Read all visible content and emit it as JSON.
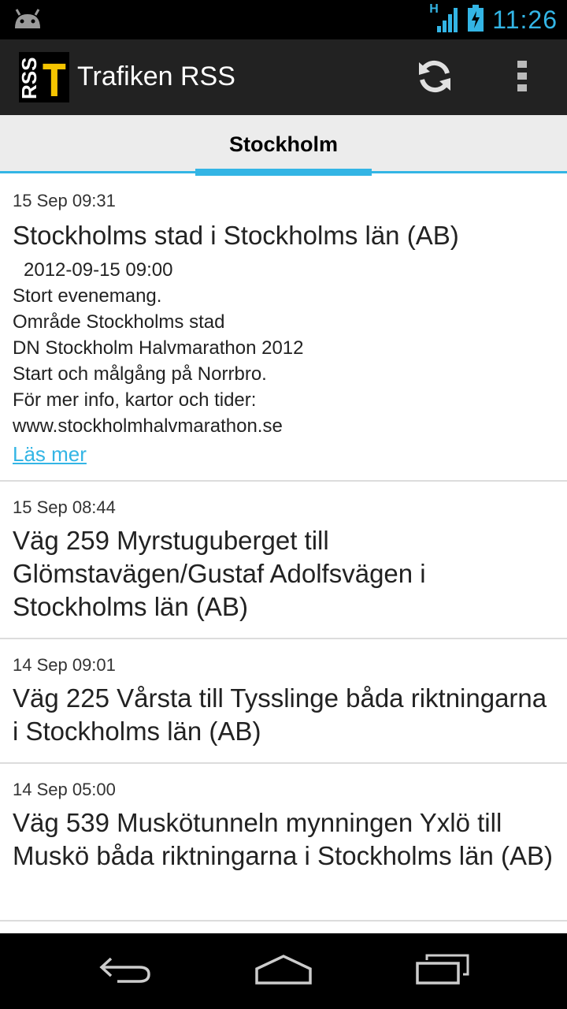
{
  "status_bar": {
    "time": "11:26",
    "network_label": "H",
    "icons": [
      "android-notification-icon",
      "signal-icon",
      "battery-charging-icon"
    ]
  },
  "action_bar": {
    "app_icon_text_rss": "RSS",
    "app_icon_text_t": "T",
    "title": "Trafiken RSS",
    "actions": [
      "refresh-icon",
      "overflow-menu-icon"
    ]
  },
  "tabs": [
    {
      "label": "Stockholm",
      "selected": true
    }
  ],
  "feed": [
    {
      "date": "15 Sep 09:31",
      "title": "Stockholms stad i Stockholms län (AB)",
      "timestamp": "2012-09-15 09:00",
      "lines": [
        "Stort evenemang.",
        "Område Stockholms stad",
        "DN Stockholm Halvmarathon 2012",
        "Start och målgång på Norrbro.",
        "För mer info, kartor och tider:",
        "www.stockholmhalvmarathon.se"
      ],
      "link": "Läs mer"
    },
    {
      "date": "15 Sep 08:44",
      "title": "Väg 259 Myrstuguberget till Glömstavägen/Gustaf Adolfsvägen i Stockholms län (AB)"
    },
    {
      "date": "14 Sep 09:01",
      "title": "Väg 225 Vårsta till Tysslinge båda riktningarna i Stockholms län (AB)"
    },
    {
      "date": "14 Sep 05:00",
      "title": "Väg 539 Muskötunneln mynningen Yxlö till Muskö båda riktningarna i Stockholms län (AB)"
    }
  ],
  "nav_bar": [
    "back-icon",
    "home-icon",
    "recent-apps-icon"
  ],
  "colors": {
    "accent": "#33b5e5",
    "action_bar": "#222222",
    "tab_bar": "#ececec"
  }
}
